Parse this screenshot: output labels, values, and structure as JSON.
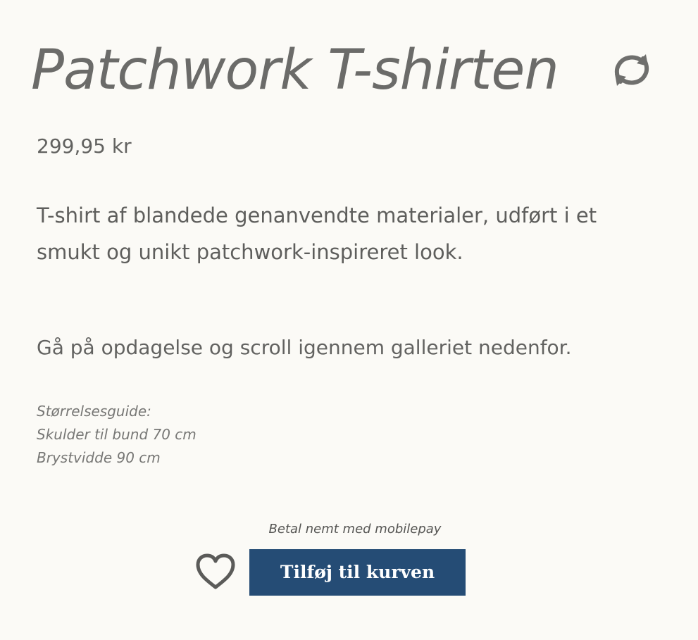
{
  "product": {
    "title": "Patchwork T-shirten",
    "price": "299,95 kr",
    "description": "T-shirt af blandede genanvendte materialer, udført i et smukt og unikt patchwork-inspireret look.",
    "gallery_note": "Gå på opdagelse og scroll igennem galleriet nedenfor."
  },
  "size_guide": {
    "heading": "Størrelsesguide:",
    "lines": [
      "Skulder til bund 70 cm",
      "Brystvidde 90 cm"
    ]
  },
  "purchase": {
    "mobilepay_note": "Betal nemt med mobilepay",
    "add_to_cart_label": "Tilføj til kurven"
  },
  "icons": {
    "refresh": "refresh-icon",
    "wishlist": "heart-icon"
  },
  "colors": {
    "background": "#fbfaf6",
    "text": "#5f5f5d",
    "button": "#254c75",
    "button_text": "#ffffff"
  }
}
